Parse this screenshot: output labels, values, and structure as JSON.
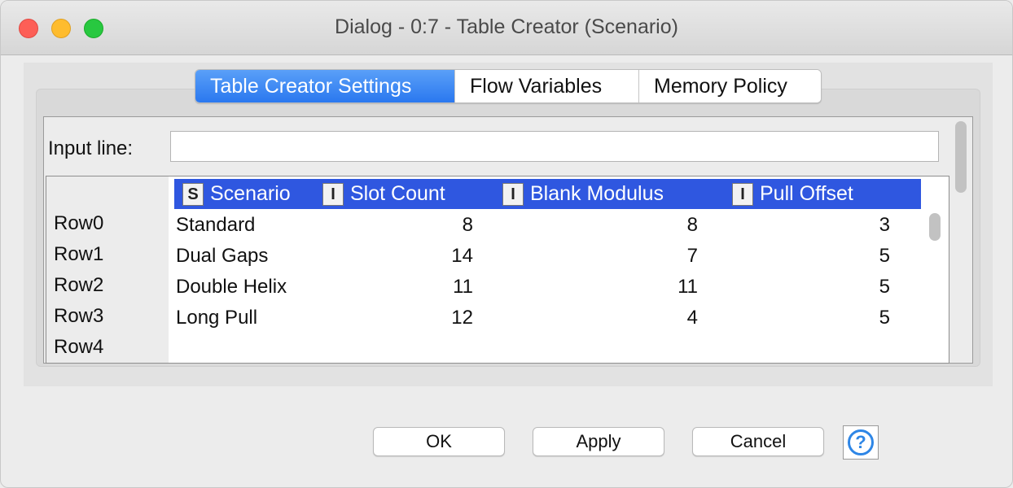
{
  "window": {
    "title": "Dialog - 0:7 - Table Creator (Scenario)"
  },
  "tabs": [
    {
      "label": "Table Creator Settings",
      "active": true
    },
    {
      "label": "Flow Variables",
      "active": false
    },
    {
      "label": "Memory Policy",
      "active": false
    }
  ],
  "input": {
    "label": "Input line:",
    "value": ""
  },
  "table": {
    "columns": [
      {
        "type": "S",
        "name": "Scenario"
      },
      {
        "type": "I",
        "name": "Slot Count"
      },
      {
        "type": "I",
        "name": "Blank Modulus"
      },
      {
        "type": "I",
        "name": "Pull Offset"
      }
    ],
    "row_names": [
      "Row0",
      "Row1",
      "Row2",
      "Row3",
      "Row4"
    ],
    "rows": [
      [
        "Standard",
        "8",
        "8",
        "3"
      ],
      [
        "Dual Gaps",
        "14",
        "7",
        "5"
      ],
      [
        "Double Helix",
        "11",
        "11",
        "5"
      ],
      [
        "Long Pull",
        "12",
        "4",
        "5"
      ]
    ]
  },
  "buttons": {
    "ok": "OK",
    "apply": "Apply",
    "cancel": "Cancel",
    "help": "?"
  },
  "colors": {
    "header_blue": "#2f57e0",
    "tab_active": "#2a78ef"
  }
}
